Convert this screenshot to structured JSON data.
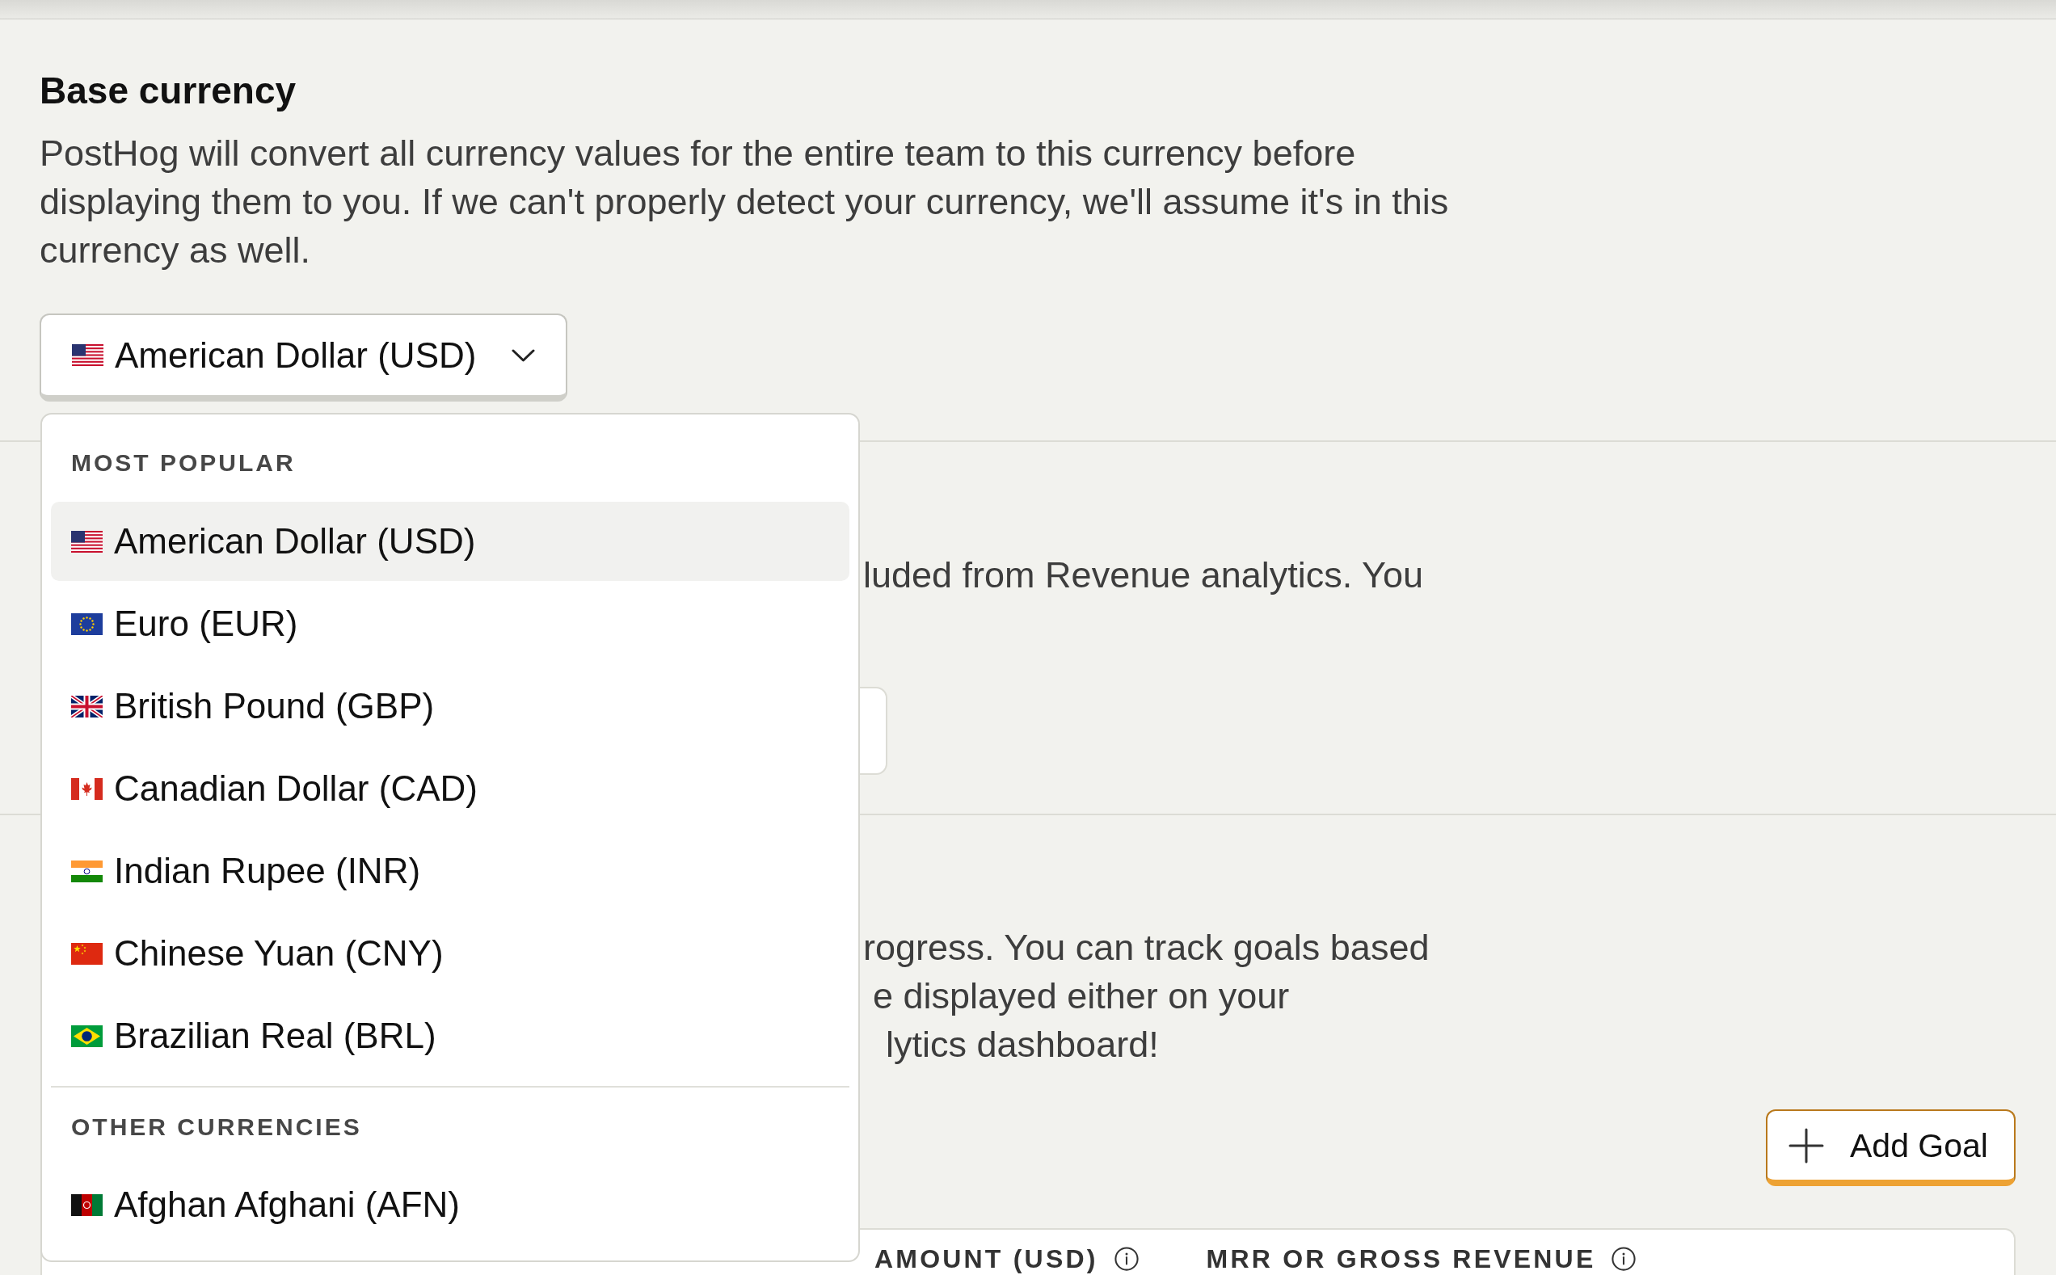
{
  "base_currency": {
    "title": "Base currency",
    "description": "PostHog will convert all currency values for the entire team to this currency before displaying them to you. If we can't properly detect your currency, we'll assume it's in this currency as well.",
    "select": {
      "value": "American Dollar (USD)",
      "expanded": true
    }
  },
  "currency_menu": {
    "groups": [
      {
        "heading": "MOST POPULAR",
        "items": [
          {
            "label": "American Dollar (USD)",
            "selected": true
          },
          {
            "label": "Euro (EUR)",
            "selected": false
          },
          {
            "label": "British Pound (GBP)",
            "selected": false
          },
          {
            "label": "Canadian Dollar (CAD)",
            "selected": false
          },
          {
            "label": "Indian Rupee (INR)",
            "selected": false
          },
          {
            "label": "Chinese Yuan (CNY)",
            "selected": false
          },
          {
            "label": "Brazilian Real (BRL)",
            "selected": false
          }
        ]
      },
      {
        "heading": "OTHER CURRENCIES",
        "items": [
          {
            "label": "Afghan Afghani (AFN)",
            "selected": false
          }
        ]
      }
    ]
  },
  "section_2": {
    "description": "luded from Revenue analytics. You"
  },
  "goals_section": {
    "description_lines": [
      "rogress. You can track goals based",
      "e displayed either on your",
      "lytics dashboard!"
    ],
    "add_button": {
      "label": "Add Goal"
    }
  },
  "goals_table": {
    "columns": [
      {
        "label": "AMOUNT (USD)",
        "info": true
      },
      {
        "label": "MRR OR GROSS REVENUE",
        "info": true
      }
    ]
  }
}
